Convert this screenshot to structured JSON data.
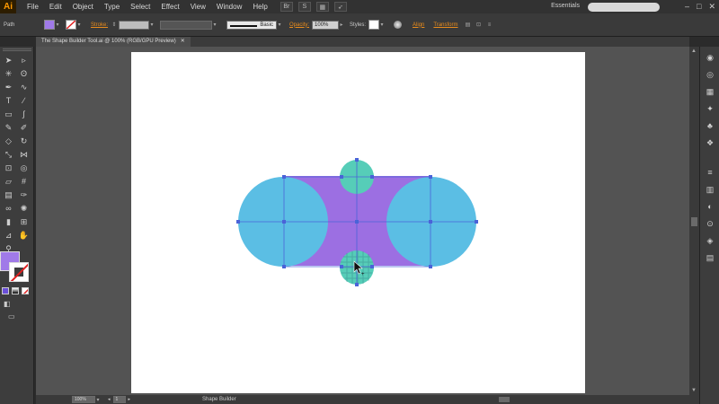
{
  "app": {
    "logo": "Ai"
  },
  "menu": [
    "File",
    "Edit",
    "Object",
    "Type",
    "Select",
    "Effect",
    "View",
    "Window",
    "Help"
  ],
  "bridge_label": "Br",
  "workspace": "Essentials",
  "window_buttons": [
    "–",
    "□",
    "✕"
  ],
  "control": {
    "selection_type": "Path",
    "stroke_label": "Stroke:",
    "brush_label": "Basic",
    "opacity_label": "Opacity:",
    "opacity_value": "100%",
    "styles_label": "Styles:",
    "align_label": "Align",
    "transform_label": "Transform",
    "fill_color": "#a07ae8"
  },
  "document": {
    "tab_title": "The Shape Builder Tool.ai @ 100% (RGB/GPU Preview)",
    "tab_close": "✕"
  },
  "status": {
    "zoom": "100%",
    "page": "1",
    "tool_name": "Shape Builder"
  },
  "colors": {
    "accent": "#e98c1c",
    "rect_fill": "#9c6fe2",
    "big_circle_fill": "#5bbee4",
    "small_circle_fill": "#56cdb8",
    "anchor": "#4a63d8"
  },
  "tools": [
    "selection-icon",
    "direct-selection-icon",
    "magic-wand-icon",
    "lasso-icon",
    "pen-icon",
    "curvature-icon",
    "type-icon",
    "line-icon",
    "rectangle-icon",
    "paintbrush-icon",
    "pencil-icon",
    "blob-brush-icon",
    "eraser-icon",
    "rotate-icon",
    "scale-icon",
    "width-icon",
    "free-transform-icon",
    "shape-builder-icon",
    "perspective-icon",
    "mesh-icon",
    "gradient-icon",
    "eyedropper-icon",
    "blend-icon",
    "symbol-sprayer-icon",
    "graph-icon",
    "artboard-icon",
    "slice-icon",
    "hand-icon",
    "zoom-icon"
  ],
  "panels": [
    "color-panel-icon",
    "color-guide-icon",
    "swatches-icon",
    "brushes-icon",
    "symbols-icon",
    "graphic-styles-icon",
    "stroke-icon",
    "gradient-panel-icon",
    "transparency-icon",
    "appearance-icon",
    "layers-icon",
    "artboards-icon"
  ]
}
